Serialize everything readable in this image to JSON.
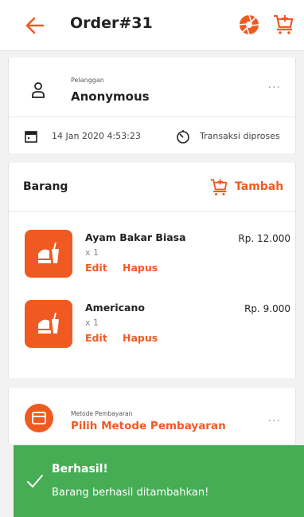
{
  "header": {
    "title": "Order#31"
  },
  "customer": {
    "label": "Pelanggan",
    "name": "Anonymous",
    "more": "...",
    "date": "14 Jan 2020 4:53:23",
    "status": "Transaksi diproses"
  },
  "items_section": {
    "title": "Barang",
    "add_label": "Tambah",
    "items": [
      {
        "name": "Ayam Bakar Biasa",
        "qty": "x 1",
        "edit": "Edit",
        "delete": "Hapus",
        "price": "Rp. 12.000"
      },
      {
        "name": "Americano",
        "qty": "x 1",
        "edit": "Edit",
        "delete": "Hapus",
        "price": "Rp. 9.000"
      }
    ]
  },
  "payment": {
    "label": "Metode Pembayaran",
    "value": "Pilih Metode Pembayaran",
    "more": "..."
  },
  "toast": {
    "title": "Berhasil!",
    "message": "Barang berhasil ditambahkan!"
  },
  "colors": {
    "accent": "#f05a22",
    "success": "#47ad55"
  },
  "icons": [
    "back-arrow-icon",
    "aperture-icon",
    "cart-add-icon",
    "person-icon",
    "calendar-icon",
    "timer-icon",
    "food-icon",
    "payment-card-icon",
    "check-icon"
  ]
}
